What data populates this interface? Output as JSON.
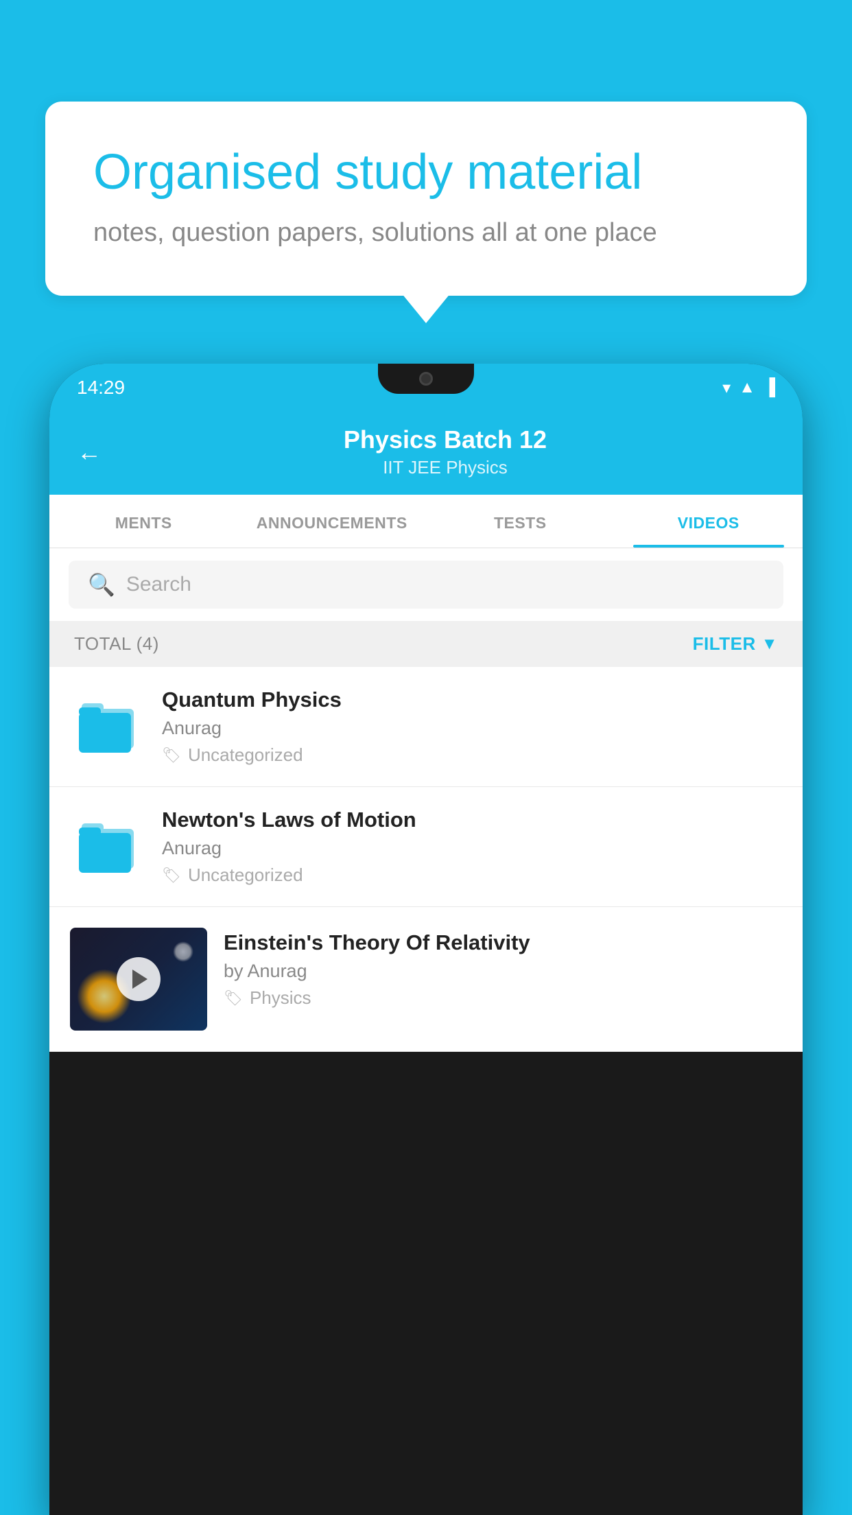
{
  "background_color": "#1BBDE8",
  "speech_bubble": {
    "heading": "Organised study material",
    "subtext": "notes, question papers, solutions all at one place"
  },
  "status_bar": {
    "time": "14:29",
    "icons": [
      "wifi",
      "signal",
      "battery"
    ]
  },
  "app_header": {
    "title": "Physics Batch 12",
    "subtitle": "IIT JEE   Physics",
    "back_label": "←"
  },
  "tabs": [
    {
      "label": "MENTS",
      "active": false
    },
    {
      "label": "ANNOUNCEMENTS",
      "active": false
    },
    {
      "label": "TESTS",
      "active": false
    },
    {
      "label": "VIDEOS",
      "active": true
    }
  ],
  "search": {
    "placeholder": "Search"
  },
  "filter_bar": {
    "total_label": "TOTAL (4)",
    "filter_label": "FILTER"
  },
  "video_items": [
    {
      "type": "folder",
      "title": "Quantum Physics",
      "author": "Anurag",
      "tag": "Uncategorized"
    },
    {
      "type": "folder",
      "title": "Newton's Laws of Motion",
      "author": "Anurag",
      "tag": "Uncategorized"
    },
    {
      "type": "video",
      "title": "Einstein's Theory Of Relativity",
      "author": "by Anurag",
      "tag": "Physics"
    }
  ]
}
